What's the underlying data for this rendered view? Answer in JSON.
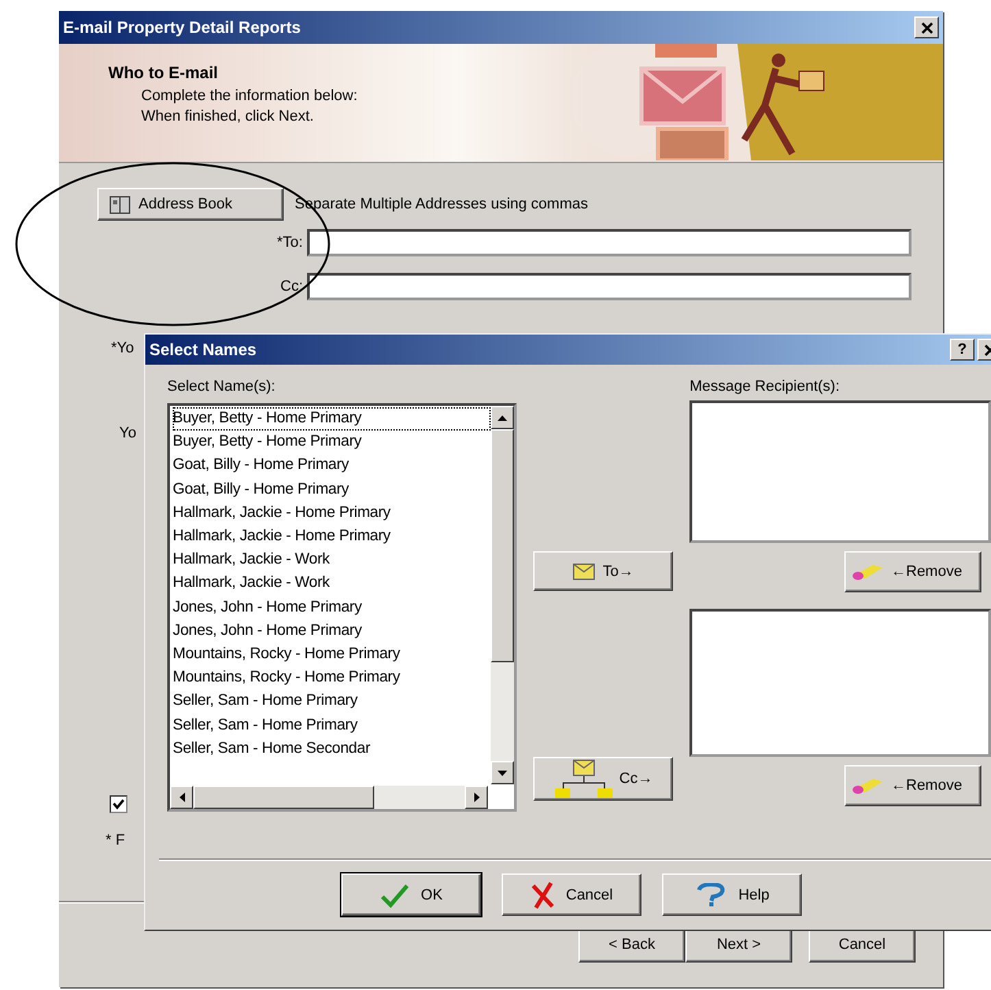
{
  "wizard": {
    "title": "E-mail Property Detail Reports",
    "header": {
      "title": "Who to E-mail",
      "lines": [
        "Complete the information below:",
        "When finished, click Next."
      ]
    },
    "address_book_button": "Address Book",
    "hint": "Separate Multiple Addresses using commas",
    "fields": [
      {
        "label": "*To:"
      },
      {
        "label": "Cc:"
      }
    ],
    "partial_labels": [
      "*Yo",
      "Yo"
    ],
    "checkbox": {
      "checked": true
    },
    "footnote": "* F",
    "buttons": [
      "< Back",
      "Next >",
      "Cancel"
    ]
  },
  "select_names": {
    "title": "Select Names",
    "help": "?",
    "list_label": "Select Name(s):",
    "names": [
      {
        "text": "Buyer, Betty - Home Primary",
        "selected": true
      },
      {
        "text": "Buyer, Betty - Home Primary",
        "selected": false
      },
      {
        "text": "Goat, Billy - Home Primary",
        "selected": false
      },
      {
        "text": "Goat, Billy - Home Primary",
        "selected": false
      },
      {
        "text": "Hallmark, Jackie - Home Primary",
        "selected": false
      },
      {
        "text": "Hallmark, Jackie - Home Primary",
        "selected": false
      },
      {
        "text": "Hallmark, Jackie - Work",
        "selected": false
      },
      {
        "text": "Hallmark, Jackie - Work",
        "selected": false
      },
      {
        "text": "Jones, John - Home Primary",
        "selected": false
      },
      {
        "text": "Jones, John - Home Primary",
        "selected": false
      },
      {
        "text": "Mountains, Rocky - Home Primary",
        "selected": false
      },
      {
        "text": "Mountains, Rocky - Home Primary",
        "selected": false
      },
      {
        "text": "Seller, Sam - Home Primary",
        "selected": false
      },
      {
        "text": "Seller, Sam - Home Primary",
        "selected": false
      },
      {
        "text": "Seller, Sam - Home Secondar",
        "selected": false
      }
    ],
    "to_button": "To→",
    "cc_button": "Cc→",
    "recipients_label": "Message Recipient(s):",
    "remove_buttons": [
      "←Remove",
      "←Remove"
    ],
    "buttons": [
      {
        "kind": "ok",
        "label": "OK"
      },
      {
        "kind": "cancel",
        "label": "Cancel"
      },
      {
        "kind": "help",
        "label": "Help"
      }
    ]
  }
}
